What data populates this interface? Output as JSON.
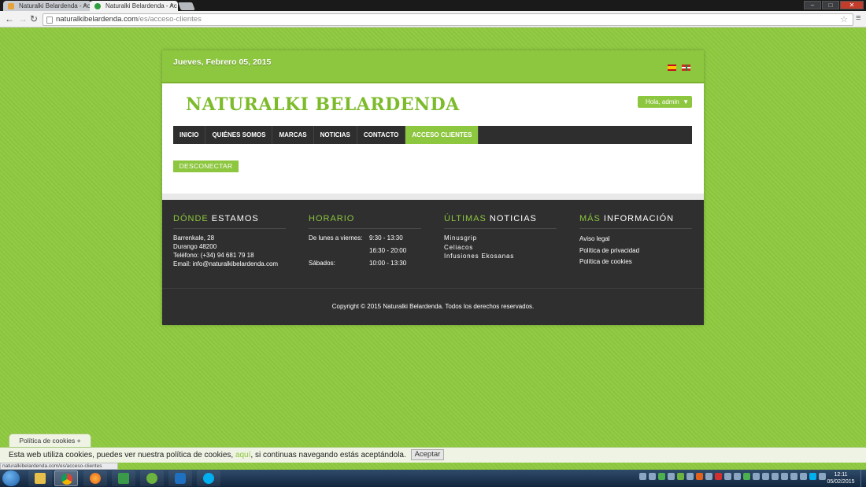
{
  "browser": {
    "tabs": [
      {
        "title": "Naturalki Belardenda - Ac",
        "active": false
      },
      {
        "title": "Naturalki Belardenda - Ac",
        "active": true
      }
    ],
    "url_host": "naturalkibelardenda.com",
    "url_path": "/es/acceso-clientes",
    "status_url": "naturalkibelardenda.com/es/acceso-clientes"
  },
  "topbar": {
    "date": "Jueves, Febrero 05, 2015"
  },
  "header": {
    "logo": "NATURALKI BELARDENDA",
    "user_menu": "Hola, admin"
  },
  "nav": {
    "items": [
      {
        "label": "INICIO"
      },
      {
        "label": "QUIÉNES SOMOS"
      },
      {
        "label": "MARCAS"
      },
      {
        "label": "NOTICIAS"
      },
      {
        "label": "CONTACTO"
      },
      {
        "label": "ACCESO CLIENTES"
      }
    ]
  },
  "main": {
    "logout_label": "DESCONECTAR"
  },
  "footer": {
    "where": {
      "title_accent": "DÓNDE",
      "title_rest": " ESTAMOS",
      "lines": [
        "Barrenkale, 28",
        "Durango 48200",
        "Teléfono: (+34) 94 681 79 18",
        "Email: info@naturalkibelardenda.com"
      ]
    },
    "hours": {
      "title_accent": "HORARIO",
      "rows": [
        {
          "label": "De lunes a viernes:",
          "value": "9:30 - 13:30"
        },
        {
          "label": "",
          "value": "16:30 - 20:00"
        },
        {
          "label": "Sábados:",
          "value": "10:00 - 13:30"
        }
      ]
    },
    "news": {
      "title_accent": "ÚLTIMAS",
      "title_rest": " NOTICIAS",
      "items": [
        "Minusgrip",
        "Celiacos",
        "Infusiones Ekosanas"
      ]
    },
    "more": {
      "title_accent": "MÁS",
      "title_rest": " INFORMACIÓN",
      "items": [
        "Aviso legal",
        "Política de privacidad",
        "Política de cookies"
      ]
    },
    "copyright": "Copyright © 2015 Naturalki Belardenda. Todos los derechos reservados."
  },
  "cookies": {
    "tab_label": "Política de cookies +",
    "text_before": "Esta web utiliza cookies, puedes ver nuestra política de cookies, ",
    "link": "aquí",
    "text_after": ", si continuas navegando estás aceptándola.",
    "accept_label": "Aceptar"
  },
  "taskbar": {
    "time": "12:11",
    "date": "05/02/2015"
  },
  "colors": {
    "brand_green": "#8dc63f",
    "dark_footer": "#2f2f2f"
  }
}
